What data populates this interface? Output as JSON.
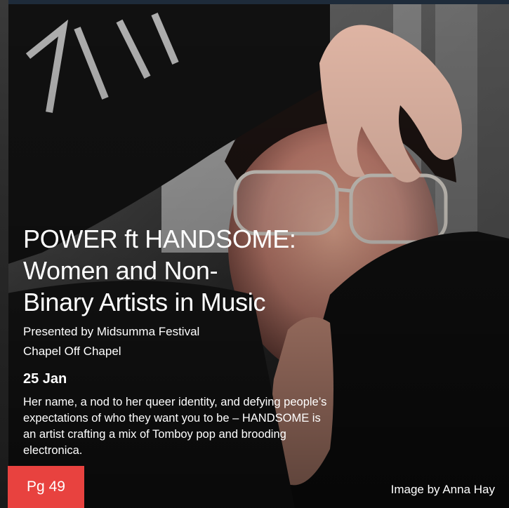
{
  "event": {
    "title_line1": "POWER ft HANDSOME:",
    "title_line2": "Women and Non-",
    "title_line3": "Binary Artists in Music",
    "presenter": "Presented by Midsumma Festival",
    "venue": "Chapel Off Chapel",
    "date": "25 Jan",
    "description": "Her name, a nod to her queer identity, and defying people’s expectations of who they want you to be – HANDSOME is an artist crafting a mix of Tomboy pop and brooding electronica."
  },
  "page_badge": "Pg 49",
  "photo_credit": "Image by Anna Hay",
  "colors": {
    "badge": "#e8423f",
    "text": "#ffffff",
    "background": "#141414"
  }
}
